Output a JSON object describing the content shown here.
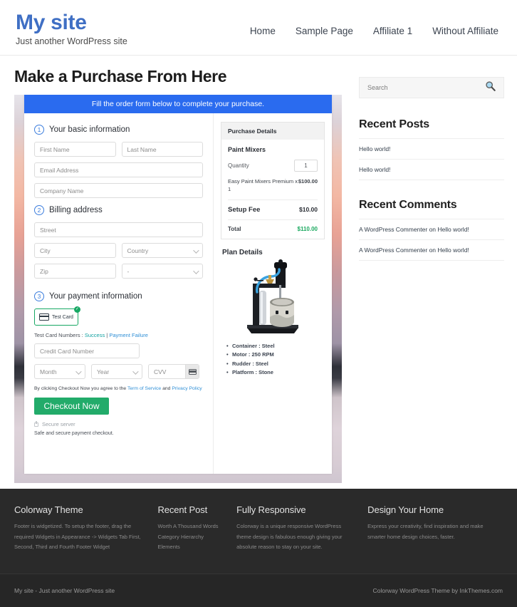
{
  "header": {
    "site_title": "My site",
    "tagline": "Just another WordPress site",
    "nav": [
      {
        "label": "Home"
      },
      {
        "label": "Sample Page"
      },
      {
        "label": "Affiliate 1"
      },
      {
        "label": "Without Affiliate"
      }
    ]
  },
  "main": {
    "page_title": "Make a Purchase From Here",
    "form": {
      "banner": "Fill the order form below to complete your purchase.",
      "step1": {
        "number": "1",
        "label": "Your basic information",
        "fields": {
          "first_name": "First Name",
          "last_name": "Last Name",
          "email": "Email Address",
          "company": "Company Name"
        }
      },
      "step2": {
        "number": "2",
        "label": "Billing address",
        "fields": {
          "street": "Street",
          "city": "City",
          "country": "Country",
          "zip": "Zip",
          "state": "-"
        }
      },
      "step3": {
        "number": "3",
        "label": "Your payment information",
        "test_card_label": "Test  Card",
        "test_card_selected_mark": "✓",
        "test_numbers_prefix": "Test Card Numbers : ",
        "test_numbers_success": "Success",
        "test_numbers_separator": " | ",
        "test_numbers_failure": "Payment Failure",
        "fields": {
          "card_number": "Credit Card Number",
          "month": "Month",
          "year": "Year",
          "cvv": "CVV"
        },
        "terms_prefix": "By clicking Checkout Now you agree to the ",
        "terms_link_1": "Term of Service",
        "terms_middle": " and ",
        "terms_link_2": "Privacy Policy",
        "checkout_button": "Checkout Now",
        "secure_server": "Secure server",
        "safe_note": "Safe and secure payment checkout."
      }
    },
    "purchase_details": {
      "heading": "Purchase Details",
      "product_title": "Paint Mixers",
      "quantity_label": "Quantity",
      "quantity_value": "1",
      "line_item_name": "Easy Paint Mixers Premium x 1",
      "line_item_amount": "$100.00",
      "setup_fee_label": "Setup Fee",
      "setup_fee_amount": "$10.00",
      "total_label": "Total",
      "total_amount": "$110.00",
      "total_color": "#1aa95f"
    },
    "plan_details": {
      "title": "Plan Details",
      "image_name": "paint-mixer-machine-photo",
      "bullets": [
        "Container : Steel",
        "Motor : 250 RPM",
        "Rudder : Steel",
        "Platform : Stone"
      ]
    }
  },
  "sidebar": {
    "search": {
      "placeholder": "Search",
      "icon": "search-icon"
    },
    "recent_posts": {
      "title": "Recent Posts",
      "items": [
        {
          "label": "Hello world!"
        },
        {
          "label": "Hello world!"
        }
      ]
    },
    "recent_comments": {
      "title": "Recent Comments",
      "items": [
        {
          "label": "A WordPress Commenter on Hello world!"
        },
        {
          "label": "A WordPress Commenter on Hello world!"
        }
      ]
    }
  },
  "footer": {
    "columns": [
      {
        "title": "Colorway Theme",
        "text": "Footer is widgetized. To setup the footer, drag the required Widgets in Appearance -> Widgets Tab First, Second, Third and Fourth Footer Widget"
      },
      {
        "title": "Recent Post",
        "items": [
          {
            "label": "Worth A Thousand Words"
          },
          {
            "label": "Category Hierarchy"
          },
          {
            "label": "Elements"
          }
        ]
      },
      {
        "title": "Fully Responsive",
        "text": "Colorway is a unique responsive WordPress theme design is fabulous enough giving your absolute reason to stay on your site."
      },
      {
        "title": "Design Your Home",
        "text": "Express your creativity, find inspiration and make smarter home design choices, faster."
      }
    ],
    "bottom_left": "My site - Just another WordPress site",
    "bottom_right": "Colorway WordPress Theme by InkThemes.com"
  },
  "colors": {
    "brand_blue": "#3f6fc4",
    "banner_blue": "#2a6bef",
    "checkout_green": "#22ab6a",
    "footer_dark": "#2a2a2a"
  }
}
